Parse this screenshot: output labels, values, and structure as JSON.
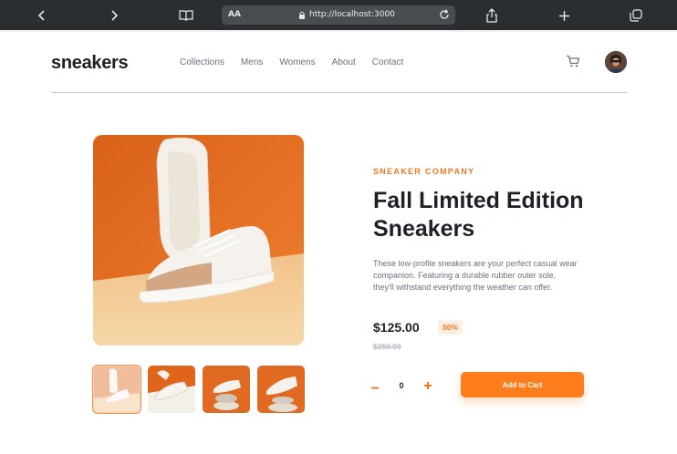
{
  "browser": {
    "text_size_label": "AA",
    "url": "http://localhost:3000"
  },
  "header": {
    "logo": "sneakers",
    "nav": [
      "Collections",
      "Mens",
      "Womens",
      "About",
      "Contact"
    ]
  },
  "product": {
    "company": "SNEAKER COMPANY",
    "title": "Fall Limited Edition Sneakers",
    "description": "These low-profile sneakers are your perfect casual wear companion. Featuring a durable rubber outer sole, they'll withstand everything the weather can offer.",
    "price": "$125.00",
    "discount": "50%",
    "original_price": "$250.00",
    "quantity": "0",
    "add_to_cart_label": "Add to Cart",
    "thumbnails_count": 4,
    "active_thumbnail": 1
  },
  "colors": {
    "accent": "#ff7d1a",
    "accent_text": "#f07a21",
    "discount_bg": "#ffeee2",
    "dark": "#1d2026",
    "muted": "#69707d"
  }
}
